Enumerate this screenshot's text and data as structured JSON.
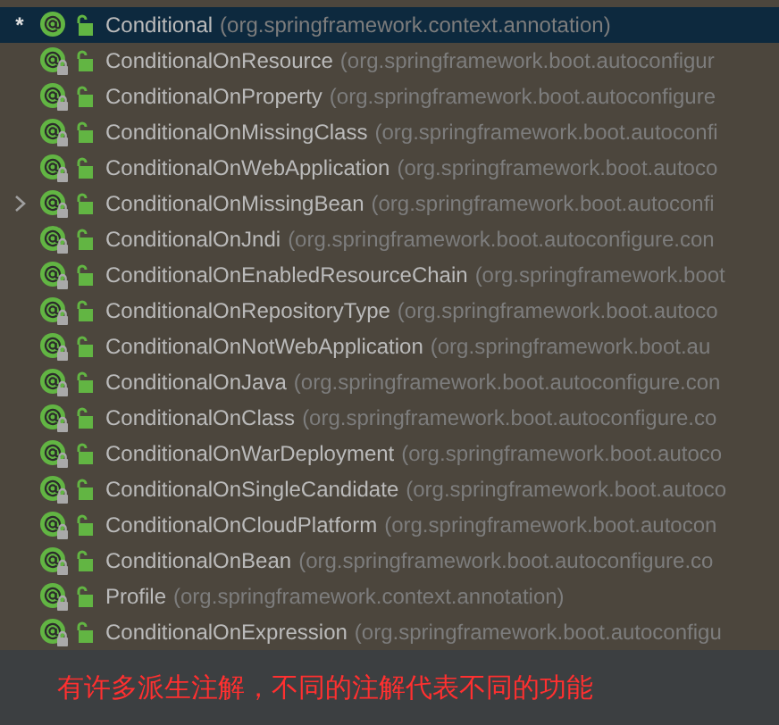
{
  "rows": [
    {
      "marker": "*",
      "name": "Conditional",
      "package": "(org.springframework.context.annotation)",
      "selected": true,
      "locked": false,
      "expandable": false
    },
    {
      "name": "ConditionalOnResource",
      "package": "(org.springframework.boot.autoconfigur",
      "selected": false,
      "locked": true,
      "expandable": false
    },
    {
      "name": "ConditionalOnProperty",
      "package": "(org.springframework.boot.autoconfigure",
      "selected": false,
      "locked": true,
      "expandable": false
    },
    {
      "name": "ConditionalOnMissingClass",
      "package": "(org.springframework.boot.autoconfi",
      "selected": false,
      "locked": true,
      "expandable": false
    },
    {
      "name": "ConditionalOnWebApplication",
      "package": "(org.springframework.boot.autoco",
      "selected": false,
      "locked": true,
      "expandable": false
    },
    {
      "name": "ConditionalOnMissingBean",
      "package": "(org.springframework.boot.autoconfi",
      "selected": false,
      "locked": true,
      "expandable": true
    },
    {
      "name": "ConditionalOnJndi",
      "package": "(org.springframework.boot.autoconfigure.con",
      "selected": false,
      "locked": true,
      "expandable": false
    },
    {
      "name": "ConditionalOnEnabledResourceChain",
      "package": "(org.springframework.boot",
      "selected": false,
      "locked": true,
      "expandable": false
    },
    {
      "name": "ConditionalOnRepositoryType",
      "package": "(org.springframework.boot.autoco",
      "selected": false,
      "locked": true,
      "expandable": false
    },
    {
      "name": "ConditionalOnNotWebApplication",
      "package": "(org.springframework.boot.au",
      "selected": false,
      "locked": true,
      "expandable": false
    },
    {
      "name": "ConditionalOnJava",
      "package": "(org.springframework.boot.autoconfigure.con",
      "selected": false,
      "locked": true,
      "expandable": false
    },
    {
      "name": "ConditionalOnClass",
      "package": "(org.springframework.boot.autoconfigure.co",
      "selected": false,
      "locked": true,
      "expandable": false
    },
    {
      "name": "ConditionalOnWarDeployment",
      "package": "(org.springframework.boot.autoco",
      "selected": false,
      "locked": true,
      "expandable": false
    },
    {
      "name": "ConditionalOnSingleCandidate",
      "package": "(org.springframework.boot.autoco",
      "selected": false,
      "locked": true,
      "expandable": false
    },
    {
      "name": "ConditionalOnCloudPlatform",
      "package": "(org.springframework.boot.autocon",
      "selected": false,
      "locked": true,
      "expandable": false
    },
    {
      "name": "ConditionalOnBean",
      "package": "(org.springframework.boot.autoconfigure.co",
      "selected": false,
      "locked": true,
      "expandable": false
    },
    {
      "name": "Profile",
      "package": "(org.springframework.context.annotation)",
      "selected": false,
      "locked": true,
      "expandable": false
    },
    {
      "name": "ConditionalOnExpression",
      "package": "(org.springframework.boot.autoconfigu",
      "selected": false,
      "locked": true,
      "expandable": false
    }
  ],
  "caption": "有许多派生注解，不同的注解代表不同的功能"
}
